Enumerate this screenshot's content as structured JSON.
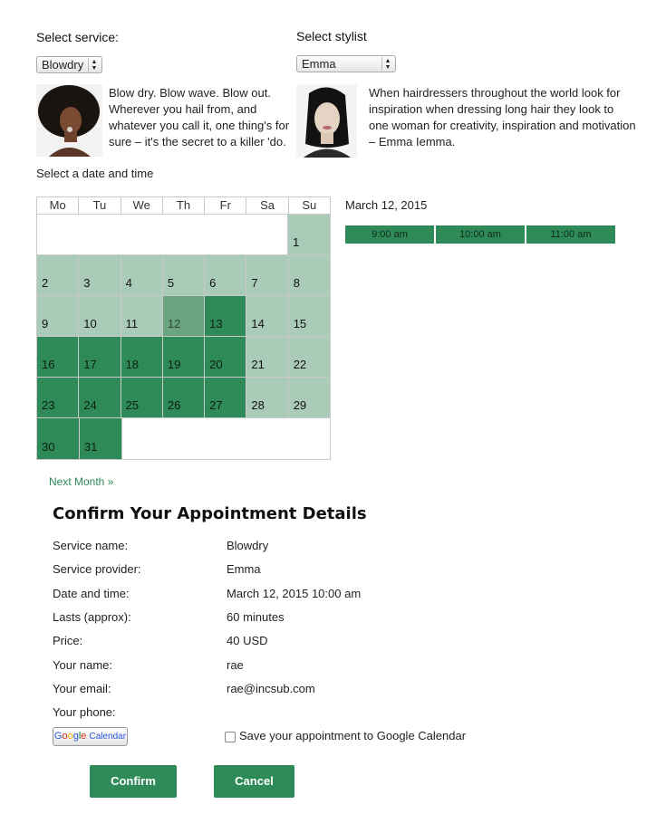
{
  "service": {
    "label": "Select service:",
    "selected": "Blowdry"
  },
  "stylist": {
    "label": "Select stylist",
    "selected": "Emma"
  },
  "service_description": "Blow dry. Blow wave. Blow out. Wherever you hail from, and whatever you call it, one thing's for sure – it's the secret to a killer 'do.",
  "stylist_description": "When hairdressers throughout the world look for inspiration when dressing long hair they look to one woman for creativity, inspiration and motivation – Emma Iemma.",
  "date_prompt": "Select a date and time",
  "calendar": {
    "weekdays": [
      "Mo",
      "Tu",
      "We",
      "Th",
      "Fr",
      "Sa",
      "Su"
    ],
    "weeks": [
      [
        {
          "d": "",
          "s": "empty"
        },
        {
          "d": "",
          "s": "empty"
        },
        {
          "d": "",
          "s": "empty"
        },
        {
          "d": "",
          "s": "empty"
        },
        {
          "d": "",
          "s": "empty"
        },
        {
          "d": "",
          "s": "empty"
        },
        {
          "d": "1",
          "s": "light"
        }
      ],
      [
        {
          "d": "2",
          "s": "light"
        },
        {
          "d": "3",
          "s": "light"
        },
        {
          "d": "4",
          "s": "light"
        },
        {
          "d": "5",
          "s": "light"
        },
        {
          "d": "6",
          "s": "light"
        },
        {
          "d": "7",
          "s": "light"
        },
        {
          "d": "8",
          "s": "light"
        }
      ],
      [
        {
          "d": "9",
          "s": "light"
        },
        {
          "d": "10",
          "s": "light"
        },
        {
          "d": "11",
          "s": "light"
        },
        {
          "d": "12",
          "s": "selected"
        },
        {
          "d": "13",
          "s": "dark"
        },
        {
          "d": "14",
          "s": "light"
        },
        {
          "d": "15",
          "s": "light"
        }
      ],
      [
        {
          "d": "16",
          "s": "dark"
        },
        {
          "d": "17",
          "s": "dark"
        },
        {
          "d": "18",
          "s": "dark"
        },
        {
          "d": "19",
          "s": "dark"
        },
        {
          "d": "20",
          "s": "dark"
        },
        {
          "d": "21",
          "s": "light"
        },
        {
          "d": "22",
          "s": "light"
        }
      ],
      [
        {
          "d": "23",
          "s": "dark"
        },
        {
          "d": "24",
          "s": "dark"
        },
        {
          "d": "25",
          "s": "dark"
        },
        {
          "d": "26",
          "s": "dark"
        },
        {
          "d": "27",
          "s": "dark"
        },
        {
          "d": "28",
          "s": "light"
        },
        {
          "d": "29",
          "s": "light"
        }
      ],
      [
        {
          "d": "30",
          "s": "dark"
        },
        {
          "d": "31",
          "s": "dark"
        },
        {
          "d": "",
          "s": "empty"
        },
        {
          "d": "",
          "s": "empty"
        },
        {
          "d": "",
          "s": "empty"
        },
        {
          "d": "",
          "s": "empty"
        },
        {
          "d": "",
          "s": "empty"
        }
      ]
    ],
    "next_month": "Next Month »"
  },
  "selected_date": "March 12, 2015",
  "time_slots": [
    "9:00 am",
    "10:00 am",
    "11:00 am"
  ],
  "confirm": {
    "title": "Confirm Your Appointment Details",
    "rows": [
      {
        "label": "Service name:",
        "value": "Blowdry"
      },
      {
        "label": "Service provider:",
        "value": "Emma"
      },
      {
        "label": "Date and time:",
        "value": "March 12, 2015 10:00 am"
      },
      {
        "label": "Lasts (approx):",
        "value": "60 minutes"
      },
      {
        "label": "Price:",
        "value": "40 USD"
      },
      {
        "label": "Your name:",
        "value": "rae"
      },
      {
        "label": "Your email:",
        "value": "rae@incsub.com"
      },
      {
        "label": "Your phone:",
        "value": ""
      }
    ],
    "gcal_badge": {
      "letters": [
        "G",
        "o",
        "o",
        "g",
        "l",
        "e"
      ],
      "word": "Calendar"
    },
    "gcal_checkbox_label": "Save your appointment to Google Calendar",
    "confirm_button": "Confirm",
    "cancel_button": "Cancel"
  },
  "colors": {
    "available": "#a9cbb7",
    "busy": "#2e8b57",
    "selected": "#6aa57f",
    "accent": "#2e8b57"
  }
}
